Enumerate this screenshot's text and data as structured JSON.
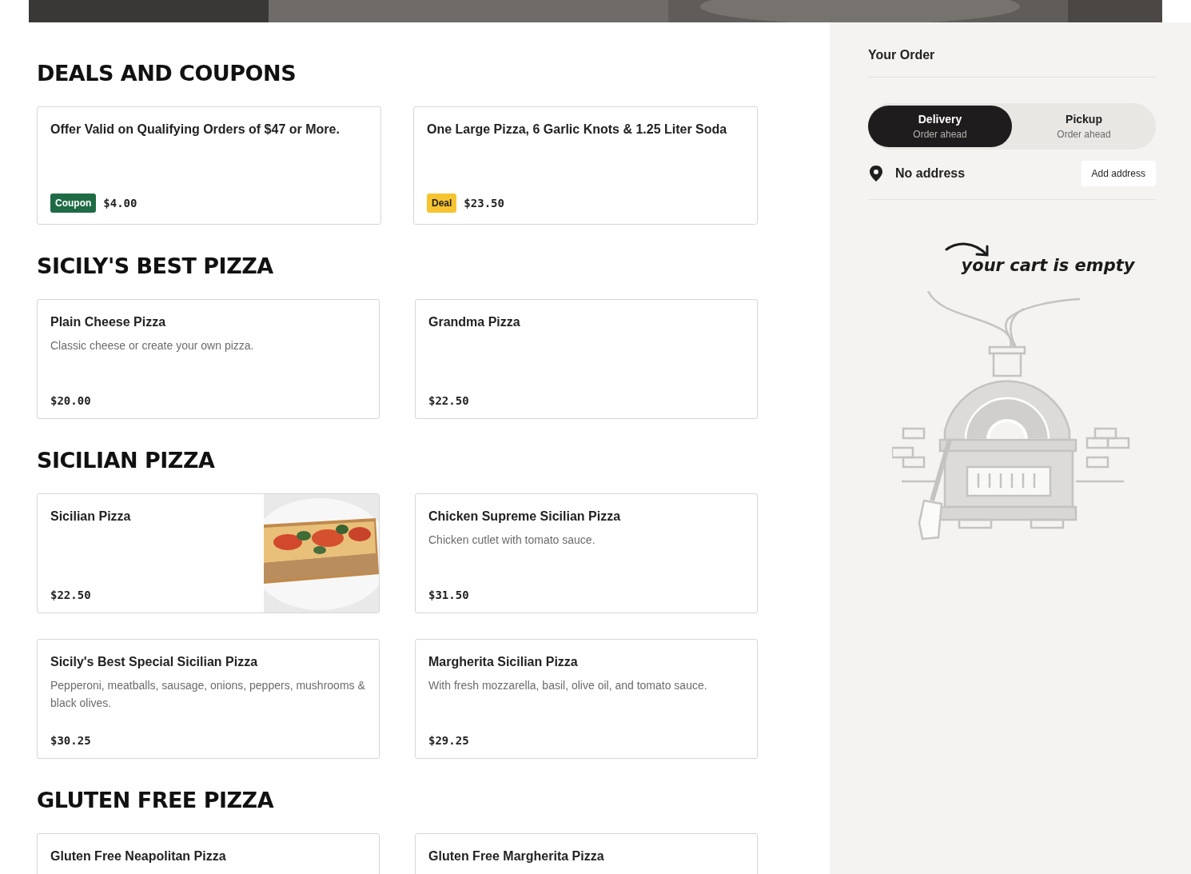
{
  "sections": [
    {
      "title": "DEALS AND COUPONS",
      "kind": "deals",
      "items": [
        {
          "title": "Offer Valid on Qualifying Orders of $47 or More.",
          "badge": {
            "label": "Coupon",
            "kind": "coupon"
          },
          "price": "$4.00"
        },
        {
          "title": "One Large Pizza, 6 Garlic Knots & 1.25 Liter Soda",
          "badge": {
            "label": "Deal",
            "kind": "deal"
          },
          "price": "$23.50"
        }
      ]
    },
    {
      "title": "SICILY'S BEST PIZZA",
      "kind": "menu",
      "items": [
        {
          "name": "Plain Cheese Pizza",
          "description": "Classic cheese or create your own pizza.",
          "price": "$20.00"
        },
        {
          "name": "Grandma Pizza",
          "price": "$22.50"
        }
      ]
    },
    {
      "title": "SICILIAN PIZZA",
      "kind": "menu",
      "items": [
        {
          "name": "Sicilian Pizza",
          "price": "$22.50"
        },
        {
          "name": "Chicken Supreme Sicilian Pizza",
          "description": "Chicken cutlet with tomato sauce.",
          "price": "$31.50"
        },
        {
          "name": "Sicily's Best Special Sicilian Pizza",
          "description": "Pepperoni, meatballs, sausage, onions, peppers, mushrooms & black olives.",
          "price": "$30.25"
        },
        {
          "name": "Margherita Sicilian Pizza",
          "description": "With fresh mozzarella, basil, olive oil, and tomato sauce.",
          "price": "$29.25"
        }
      ]
    },
    {
      "title": "GLUTEN FREE PIZZA",
      "kind": "menu",
      "items": [
        {
          "name": "Gluten Free Neapolitan Pizza"
        },
        {
          "name": "Gluten Free Margherita Pizza"
        }
      ]
    }
  ],
  "order": {
    "title": "Your Order",
    "modes": [
      {
        "label": "Delivery",
        "sublabel": "Order ahead",
        "selected": true
      },
      {
        "label": "Pickup",
        "sublabel": "Order ahead",
        "selected": false
      }
    ],
    "address": {
      "value": "No address",
      "button": "Add address"
    },
    "empty_message": "your cart is empty"
  }
}
